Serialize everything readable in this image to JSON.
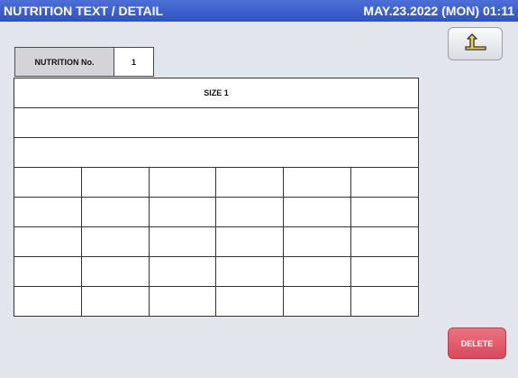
{
  "header": {
    "title": "NUTRITION TEXT / DETAIL",
    "datetime": "MAY.23.2022 (MON) 01:11"
  },
  "nutrition": {
    "label": "NUTRITION No.",
    "value": "1"
  },
  "table": {
    "size_header": "SIZE 1",
    "text_rows": [
      "",
      ""
    ],
    "grid_rows": [
      [
        "",
        "",
        "",
        "",
        "",
        ""
      ],
      [
        "",
        "",
        "",
        "",
        "",
        ""
      ],
      [
        "",
        "",
        "",
        "",
        "",
        ""
      ],
      [
        "",
        "",
        "",
        "",
        "",
        ""
      ],
      [
        "",
        "",
        "",
        "",
        "",
        ""
      ]
    ]
  },
  "buttons": {
    "back_icon": "return-arrow-icon",
    "delete_label": "DELETE"
  },
  "colors": {
    "titlebar": "#3a5ccc",
    "background": "#e2e5ec",
    "delete": "#e05a6a"
  }
}
